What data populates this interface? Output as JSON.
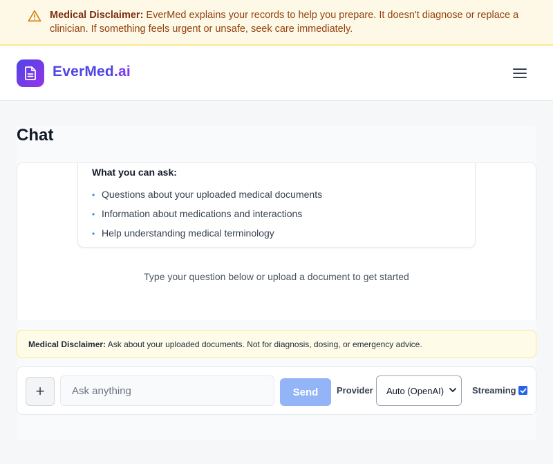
{
  "top_banner": {
    "title": "Medical Disclaimer:",
    "text": " EverMed explains your records to help you prepare. It doesn't diagnose or replace a clinician. If something feels urgent or unsafe, seek care immediately.",
    "icon": "warning-triangle-icon"
  },
  "header": {
    "brand_main": "EverMed",
    "brand_tld": ".ai",
    "logo_icon": "document-icon",
    "menu_icon": "hamburger-menu-icon"
  },
  "page": {
    "title": "Chat"
  },
  "info_card": {
    "title": "What you can ask:",
    "items": [
      "Questions about your uploaded medical documents",
      "Information about medications and interactions",
      "Help understanding medical terminology"
    ]
  },
  "hint": "Type your question below or upload a document to get started",
  "chat_disclaimer": {
    "title": "Medical Disclaimer:",
    "text": " Ask about your uploaded documents. Not for diagnosis, dosing, or emergency advice."
  },
  "input_bar": {
    "plus_label": "+",
    "placeholder": "Ask anything",
    "value": "",
    "send_label": "Send",
    "provider_label": "Provider",
    "provider_selected": "Auto (OpenAI)",
    "streaming_label": "Streaming",
    "streaming_checked": true
  },
  "colors": {
    "brand": "#4f46e5",
    "accent_purple": "#7c3aed",
    "send_button": "#93b4f7",
    "banner_bg": "#fef9e7",
    "checkbox": "#2563eb"
  }
}
